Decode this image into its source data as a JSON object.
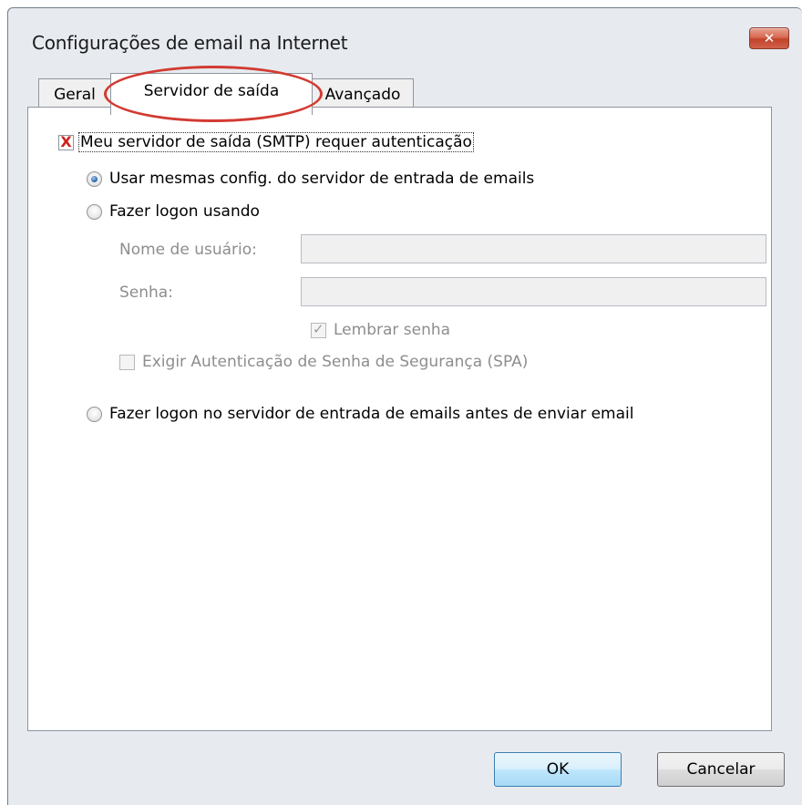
{
  "window": {
    "title": "Configurações de email na Internet",
    "close_symbol": "✕"
  },
  "tabs": [
    {
      "label": "Geral"
    },
    {
      "label": "Servidor de saída",
      "active": true
    },
    {
      "label": "Avançado"
    }
  ],
  "smtp_auth": {
    "label": "Meu servidor de saída (SMTP) requer autenticação",
    "checked": true,
    "mark": "X"
  },
  "options": {
    "same_settings": {
      "label": "Usar mesmas config. do servidor de entrada de emails",
      "selected": true
    },
    "logon_using": {
      "label": "Fazer logon usando",
      "selected": false
    },
    "logon_incoming_first": {
      "label": "Fazer logon no servidor de entrada de emails antes de enviar email",
      "selected": false
    }
  },
  "credentials": {
    "username_label": "Nome de usuário:",
    "username_value": "",
    "password_label": "Senha:",
    "password_value": "",
    "remember_password": {
      "label": "Lembrar senha",
      "checked": true
    },
    "spa": {
      "label": "Exigir Autenticação de Senha de Segurança (SPA)",
      "checked": false
    }
  },
  "buttons": {
    "ok": "OK",
    "cancel": "Cancelar"
  },
  "colors": {
    "highlight_ellipse": "#d23b32",
    "checkbox_x": "#d0201a"
  }
}
